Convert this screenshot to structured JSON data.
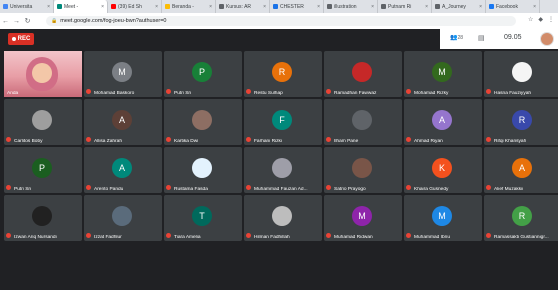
{
  "browser": {
    "tabs": [
      {
        "label": "Universita",
        "color": "#4285f4",
        "active": false
      },
      {
        "label": "Meet - ",
        "color": "#00897b",
        "active": true
      },
      {
        "label": "(39) Ed Sh",
        "color": "#ff0000",
        "active": false
      },
      {
        "label": "Beranda - ",
        "color": "#fbbc04",
        "active": false
      },
      {
        "label": "Kursus: AR",
        "color": "#5f6368",
        "active": false
      },
      {
        "label": "CHESTER",
        "color": "#1a73e8",
        "active": false
      },
      {
        "label": "illustration",
        "color": "#5f6368",
        "active": false
      },
      {
        "label": "Putnam Ri",
        "color": "#5f6368",
        "active": false
      },
      {
        "label": "A_Journey",
        "color": "#5f6368",
        "active": false
      },
      {
        "label": "Facebook",
        "color": "#1877f2",
        "active": false
      }
    ],
    "url": "meet.google.com/fog-joeu-bwn?authuser=0"
  },
  "meet": {
    "rec_label": "REC",
    "time": "09.05",
    "people_count": "28",
    "self_name": "Anda",
    "participants": [
      {
        "name": "Mohamad Baskoro",
        "initial": "M",
        "color": "#7b7f85",
        "photo": false
      },
      {
        "name": "Putri Sri",
        "initial": "P",
        "color": "#188038",
        "photo": false
      },
      {
        "name": "Restu Sulhap",
        "initial": "R",
        "color": "#e8710a",
        "photo": false
      },
      {
        "name": "Ramadhan Fawwaz",
        "initial": "",
        "color": "#c62828",
        "photo": true
      },
      {
        "name": "Mohamad Rizky",
        "initial": "M",
        "color": "#33691e",
        "photo": false
      },
      {
        "name": "Hasna Fauziyyah",
        "initial": "",
        "color": "#f5f5f5",
        "photo": true
      },
      {
        "name": "Carlitos Boby",
        "initial": "",
        "color": "#9e9e9e",
        "photo": true
      },
      {
        "name": "Allisa Zahrah",
        "initial": "A",
        "color": "#5d4037",
        "photo": false
      },
      {
        "name": "Kartika Dwi",
        "initial": "",
        "color": "#8d6e63",
        "photo": true
      },
      {
        "name": "Farhani Rizki",
        "initial": "F",
        "color": "#00897b",
        "photo": false
      },
      {
        "name": "Ilham Pane",
        "initial": "",
        "color": "#5f6368",
        "photo": true
      },
      {
        "name": "Ahmad Riyan",
        "initial": "A",
        "color": "#9575cd",
        "photo": false
      },
      {
        "name": "Rifqi Khansyah",
        "initial": "R",
        "color": "#3949ab",
        "photo": false
      },
      {
        "name": "Putri Sri",
        "initial": "P",
        "color": "#1b5e20",
        "photo": false
      },
      {
        "name": "Arento Pandu",
        "initial": "A",
        "color": "#00897b",
        "photo": false
      },
      {
        "name": "Rustama Fasda",
        "initial": "",
        "color": "#e3f2fd",
        "photo": true
      },
      {
        "name": "Muhammad Fauzan Ad...",
        "initial": "",
        "color": "#9e9ea8",
        "photo": true
      },
      {
        "name": "Satrio Prayogo",
        "initial": "",
        "color": "#795548",
        "photo": true
      },
      {
        "name": "Khaira Gusnedy",
        "initial": "K",
        "color": "#f4511e",
        "photo": false
      },
      {
        "name": "Alief Muzakkii",
        "initial": "A",
        "color": "#e8710a",
        "photo": false
      },
      {
        "name": "Izwan Ariq Nursandi",
        "initial": "",
        "color": "#212121",
        "photo": true
      },
      {
        "name": "Izzat Fadhlur",
        "initial": "",
        "color": "#5a6b7b",
        "photo": true
      },
      {
        "name": "Tiara Amelia",
        "initial": "T",
        "color": "#00695c",
        "photo": false
      },
      {
        "name": "Hilman Fadhillah",
        "initial": "",
        "color": "#bdbdbd",
        "photo": true
      },
      {
        "name": "Muhamad Ridwan",
        "initial": "M",
        "color": "#8e24aa",
        "photo": false
      },
      {
        "name": "Muhammad Ibnu",
        "initial": "M",
        "color": "#1e88e5",
        "photo": false
      },
      {
        "name": "Ramassakti Gustiannigr...",
        "initial": "R",
        "color": "#43a047",
        "photo": false
      }
    ]
  }
}
